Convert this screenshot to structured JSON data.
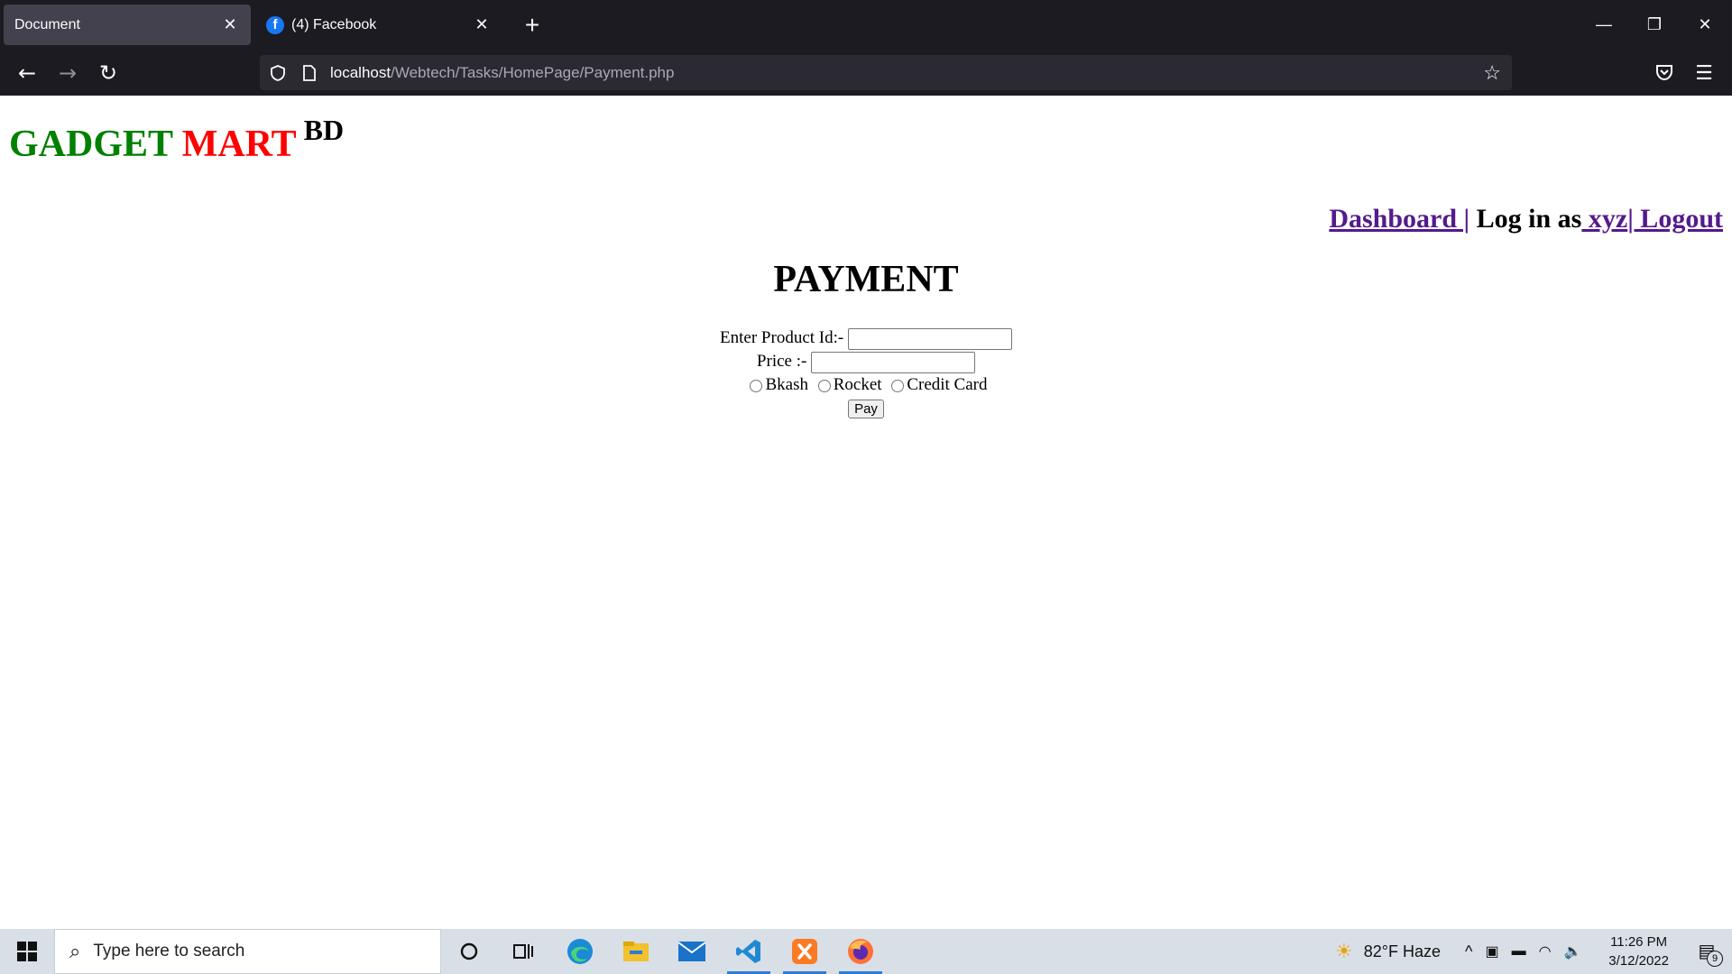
{
  "browser": {
    "tabs": [
      {
        "title": "Document",
        "active": true
      },
      {
        "title": "(4) Facebook",
        "active": false
      }
    ],
    "url": {
      "host": "localhost",
      "path": "/Webtech/Tasks/HomePage/Payment.php"
    }
  },
  "site": {
    "logo": {
      "part1": "GADGET",
      "part2": "MART",
      "suffix": "BD"
    },
    "nav": {
      "dashboard": "Dashboard |",
      "logged_in_prefix": "Log in as",
      "username": " xyz",
      "logout": "| Logout"
    }
  },
  "page": {
    "title": "PAYMENT",
    "form": {
      "product_id_label": "Enter Product Id:-",
      "product_id_value": "",
      "price_label": "Price :-",
      "price_value": "",
      "payment_methods": [
        "Bkash",
        "Rocket",
        "Credit Card"
      ],
      "pay_button": "Pay"
    }
  },
  "taskbar": {
    "search_placeholder": "Type here to search",
    "weather": "82°F  Haze",
    "time": "11:26 PM",
    "date": "3/12/2022",
    "notification_count": "9"
  },
  "colors": {
    "logo_green": "#008000",
    "logo_red": "#ff0000",
    "link_visited": "#551a8b",
    "browser_chrome": "#1c1b22"
  }
}
